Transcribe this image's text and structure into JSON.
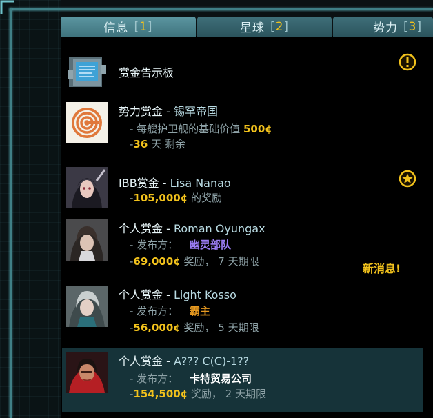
{
  "tabs": [
    {
      "label": "信息",
      "num": "1"
    },
    {
      "label": "星球",
      "num": "2"
    },
    {
      "label": "势力",
      "num": "3"
    }
  ],
  "bounties": [
    {
      "title": "赏金告示板"
    },
    {
      "title_prefix": "势力赏金 - ",
      "title_name": "锡罕帝国",
      "line1_prefix": "- 每艘护卫舰的基础价值 ",
      "line1_value": "500¢",
      "line2_value": "36",
      "line2_suffix": " 天 剩余"
    },
    {
      "title_prefix": "IBB赏金 - ",
      "title_name": "Lisa Nanao",
      "line1_value": "105,000¢",
      "line1_suffix": " 的奖励"
    },
    {
      "title_prefix": "个人赏金 - ",
      "title_name": "Roman Oyungax",
      "line1_prefix": "- 发布方： ",
      "issuer": "幽灵部队",
      "line2_value": "69,000¢",
      "line2_suffix": " 奖励， 7 天期限"
    },
    {
      "title_prefix": "个人赏金 - ",
      "title_name": "Light Kosso",
      "line1_prefix": "- 发布方： ",
      "issuer": "霸主",
      "line2_value": "56,000¢",
      "line2_suffix": " 奖励， 5 天期限"
    },
    {
      "title_prefix": "个人赏金 - ",
      "title_name": "A??? C(C)-1??",
      "line1_prefix": "- 发布方： ",
      "issuer": "卡特贸易公司",
      "line2_value": "154,500¢",
      "line2_suffix": " 奖励， 2 天期限"
    }
  ],
  "new_message": "新消息!",
  "colors": {
    "accent_gold": "#f2c21c",
    "tab_bg": "#2b545d",
    "selected_row": "#163339"
  }
}
